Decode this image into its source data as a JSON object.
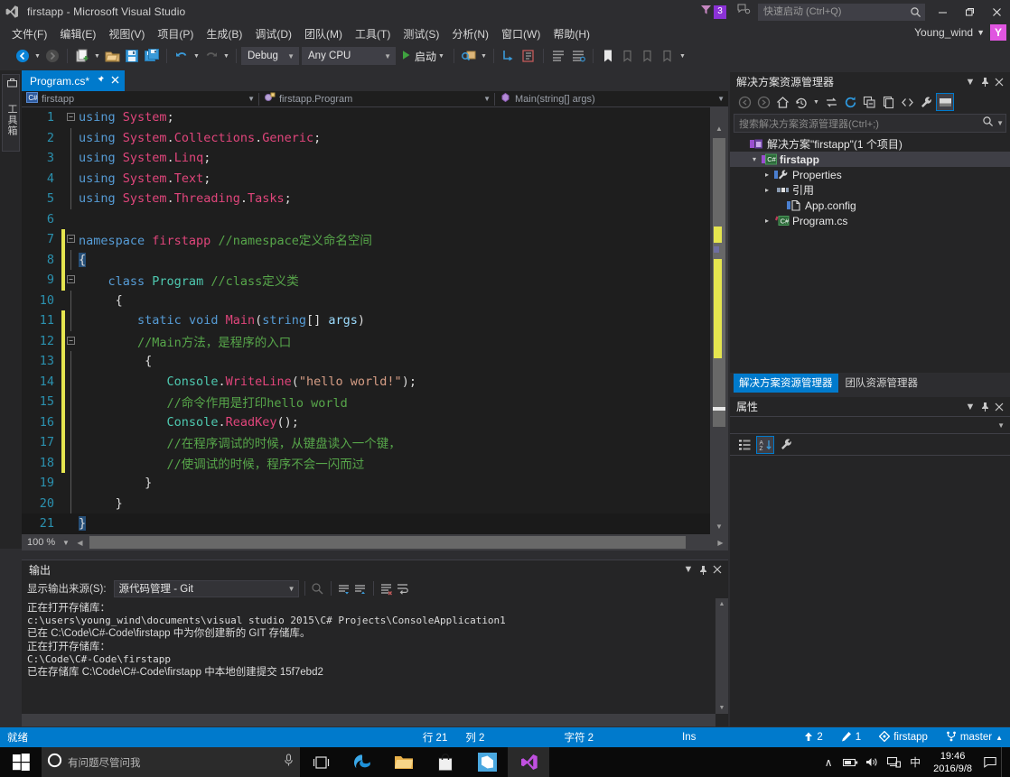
{
  "titlebar": {
    "app_title": "firstapp - Microsoft Visual Studio",
    "notification_count": "3",
    "quick_launch_placeholder": "快速启动 (Ctrl+Q)",
    "minimize": "─",
    "maximize": "❐",
    "close": "✕"
  },
  "menubar": {
    "items": [
      {
        "label": "文件(F)"
      },
      {
        "label": "编辑(E)"
      },
      {
        "label": "视图(V)"
      },
      {
        "label": "项目(P)"
      },
      {
        "label": "生成(B)"
      },
      {
        "label": "调试(D)"
      },
      {
        "label": "团队(M)"
      },
      {
        "label": "工具(T)"
      },
      {
        "label": "测试(S)"
      },
      {
        "label": "分析(N)"
      },
      {
        "label": "窗口(W)"
      },
      {
        "label": "帮助(H)"
      }
    ],
    "account_name": "Young_wind",
    "account_initial": "Y"
  },
  "toolbar": {
    "config": "Debug",
    "platform": "Any CPU",
    "start_label": "启动"
  },
  "left_rail": {
    "toolbox_label": "工具箱"
  },
  "editor": {
    "tab_label": "Program.cs*",
    "breadcrumb": {
      "project": "firstapp",
      "type": "firstapp.Program",
      "member": "Main(string[] args)"
    },
    "zoom_level": "100 %",
    "lines": [
      {
        "n": "1",
        "change": "none",
        "fold": "minus",
        "guide": false,
        "tokens": [
          {
            "t": "using ",
            "c": "kw"
          },
          {
            "t": "System",
            "c": "ns"
          },
          {
            "t": ";",
            "c": "pln"
          }
        ]
      },
      {
        "n": "2",
        "change": "none",
        "fold": "none",
        "guide": true,
        "tokens": [
          {
            "t": "using ",
            "c": "kw"
          },
          {
            "t": "System",
            "c": "ns"
          },
          {
            "t": ".",
            "c": "pln"
          },
          {
            "t": "Collections",
            "c": "ns"
          },
          {
            "t": ".",
            "c": "pln"
          },
          {
            "t": "Generic",
            "c": "ns"
          },
          {
            "t": ";",
            "c": "pln"
          }
        ]
      },
      {
        "n": "3",
        "change": "none",
        "fold": "none",
        "guide": true,
        "tokens": [
          {
            "t": "using ",
            "c": "kw"
          },
          {
            "t": "System",
            "c": "ns"
          },
          {
            "t": ".",
            "c": "pln"
          },
          {
            "t": "Linq",
            "c": "ns"
          },
          {
            "t": ";",
            "c": "pln"
          }
        ]
      },
      {
        "n": "4",
        "change": "none",
        "fold": "none",
        "guide": true,
        "tokens": [
          {
            "t": "using ",
            "c": "kw"
          },
          {
            "t": "System",
            "c": "ns"
          },
          {
            "t": ".",
            "c": "pln"
          },
          {
            "t": "Text",
            "c": "ns"
          },
          {
            "t": ";",
            "c": "pln"
          }
        ]
      },
      {
        "n": "5",
        "change": "none",
        "fold": "none",
        "guide": true,
        "tokens": [
          {
            "t": "using ",
            "c": "kw"
          },
          {
            "t": "System",
            "c": "ns"
          },
          {
            "t": ".",
            "c": "pln"
          },
          {
            "t": "Threading",
            "c": "ns"
          },
          {
            "t": ".",
            "c": "pln"
          },
          {
            "t": "Tasks",
            "c": "ns"
          },
          {
            "t": ";",
            "c": "pln"
          }
        ]
      },
      {
        "n": "6",
        "change": "none",
        "fold": "none",
        "guide": false,
        "tokens": []
      },
      {
        "n": "7",
        "change": "yellow",
        "fold": "minus",
        "guide": false,
        "tokens": [
          {
            "t": "namespace ",
            "c": "kw"
          },
          {
            "t": "firstapp",
            "c": "ns"
          },
          {
            "t": " ",
            "c": "pln"
          },
          {
            "t": "//namespace定义命名空间",
            "c": "cmt"
          }
        ]
      },
      {
        "n": "8",
        "change": "yellow",
        "fold": "none",
        "guide": true,
        "tokens": [
          {
            "t": "{",
            "c": "sel"
          }
        ]
      },
      {
        "n": "9",
        "change": "yellow",
        "fold": "minus",
        "guide": true,
        "tokens": [
          {
            "t": "    ",
            "c": "pln"
          },
          {
            "t": "class ",
            "c": "kw"
          },
          {
            "t": "Program",
            "c": "cls"
          },
          {
            "t": " ",
            "c": "pln"
          },
          {
            "t": "//class定义类",
            "c": "cmt"
          }
        ]
      },
      {
        "n": "10",
        "change": "none",
        "fold": "none",
        "guide": true,
        "tokens": [
          {
            "t": "     {",
            "c": "pln"
          }
        ]
      },
      {
        "n": "11",
        "change": "yellow",
        "fold": "none",
        "guide": true,
        "tokens": [
          {
            "t": "        ",
            "c": "pln"
          },
          {
            "t": "static ",
            "c": "kw"
          },
          {
            "t": "void ",
            "c": "kw"
          },
          {
            "t": "Main",
            "c": "mth"
          },
          {
            "t": "(",
            "c": "pln"
          },
          {
            "t": "string",
            "c": "kw"
          },
          {
            "t": "[] ",
            "c": "pln"
          },
          {
            "t": "args",
            "c": "par"
          },
          {
            "t": ")",
            "c": "pln"
          }
        ]
      },
      {
        "n": "12",
        "change": "yellow",
        "fold": "minus",
        "guide": true,
        "tokens": [
          {
            "t": "        ",
            "c": "pln"
          },
          {
            "t": "//Main方法，是程序的入口",
            "c": "cmt"
          }
        ]
      },
      {
        "n": "13",
        "change": "yellow",
        "fold": "none",
        "guide": true,
        "tokens": [
          {
            "t": "         {",
            "c": "pln"
          }
        ]
      },
      {
        "n": "14",
        "change": "yellow",
        "fold": "none",
        "guide": true,
        "tokens": [
          {
            "t": "            ",
            "c": "pln"
          },
          {
            "t": "Console",
            "c": "typ"
          },
          {
            "t": ".",
            "c": "pln"
          },
          {
            "t": "WriteLine",
            "c": "mth"
          },
          {
            "t": "(",
            "c": "pln"
          },
          {
            "t": "\"hello world!\"",
            "c": "str"
          },
          {
            "t": ");",
            "c": "pln"
          }
        ]
      },
      {
        "n": "15",
        "change": "yellow",
        "fold": "none",
        "guide": true,
        "tokens": [
          {
            "t": "            ",
            "c": "pln"
          },
          {
            "t": "//命令作用是打印hello world",
            "c": "cmt"
          }
        ]
      },
      {
        "n": "16",
        "change": "yellow",
        "fold": "none",
        "guide": true,
        "tokens": [
          {
            "t": "            ",
            "c": "pln"
          },
          {
            "t": "Console",
            "c": "typ"
          },
          {
            "t": ".",
            "c": "pln"
          },
          {
            "t": "ReadKey",
            "c": "mth"
          },
          {
            "t": "();",
            "c": "pln"
          }
        ]
      },
      {
        "n": "17",
        "change": "yellow",
        "fold": "none",
        "guide": true,
        "tokens": [
          {
            "t": "            ",
            "c": "pln"
          },
          {
            "t": "//在程序调试的时候，从键盘读入一个键，",
            "c": "cmt"
          }
        ]
      },
      {
        "n": "18",
        "change": "yellow",
        "fold": "none",
        "guide": true,
        "tokens": [
          {
            "t": "            ",
            "c": "pln"
          },
          {
            "t": "//使调试的时候，程序不会一闪而过",
            "c": "cmt"
          }
        ]
      },
      {
        "n": "19",
        "change": "none",
        "fold": "none",
        "guide": true,
        "tokens": [
          {
            "t": "         }",
            "c": "pln"
          }
        ]
      },
      {
        "n": "20",
        "change": "none",
        "fold": "none",
        "guide": true,
        "tokens": [
          {
            "t": "     }",
            "c": "pln"
          }
        ]
      },
      {
        "n": "21",
        "change": "none",
        "fold": "none",
        "guide": false,
        "current": true,
        "tokens": [
          {
            "t": "}",
            "c": "sel"
          }
        ]
      }
    ]
  },
  "output": {
    "title": "输出",
    "source_label": "显示输出来源(S):",
    "source_value": "源代码管理 - Git",
    "lines": [
      {
        "text": "正在打开存储库：",
        "mono": false
      },
      {
        "text": "c:\\users\\young_wind\\documents\\visual studio 2015\\C# Projects\\ConsoleApplication1",
        "mono": true
      },
      {
        "text": "已在 C:\\Code\\C#-Code\\firstapp 中为你创建新的 GIT 存储库。",
        "mono": false
      },
      {
        "text": "正在打开存储库：",
        "mono": false
      },
      {
        "text": "C:\\Code\\C#-Code\\firstapp",
        "mono": true
      },
      {
        "text": "已在存储库 C:\\Code\\C#-Code\\firstapp 中本地创建提交 15f7ebd2",
        "mono": false
      }
    ]
  },
  "solution_explorer": {
    "title": "解决方案资源管理器",
    "search_placeholder": "搜索解决方案资源管理器(Ctrl+;)",
    "tree": [
      {
        "label": "解决方案\"firstapp\"(1 个项目)",
        "indent": 0,
        "twisty": "none",
        "icon": "solution-icon",
        "bold": false,
        "selected": false
      },
      {
        "label": "firstapp",
        "indent": 1,
        "twisty": "down",
        "icon": "csproj-icon",
        "bold": true,
        "selected": true
      },
      {
        "label": "Properties",
        "indent": 2,
        "twisty": "right",
        "icon": "properties-icon",
        "bold": false,
        "selected": false
      },
      {
        "label": "引用",
        "indent": 2,
        "twisty": "right",
        "icon": "references-icon",
        "bold": false,
        "selected": false
      },
      {
        "label": "App.config",
        "indent": 3,
        "twisty": "none",
        "icon": "config-icon",
        "bold": false,
        "selected": false
      },
      {
        "label": "Program.cs",
        "indent": 2,
        "twisty": "right",
        "icon": "csfile-icon",
        "bold": false,
        "selected": false
      }
    ]
  },
  "dock_tabs": [
    {
      "label": "解决方案资源管理器",
      "active": true
    },
    {
      "label": "团队资源管理器",
      "active": false
    }
  ],
  "properties_panel": {
    "title": "属性"
  },
  "statusbar": {
    "ready": "就绪",
    "line_label": "行 21",
    "col_label": "列 2",
    "char_label": "字符 2",
    "ins_label": "Ins",
    "ahead_count": "2",
    "edit_count": "1",
    "repo": "firstapp",
    "branch": "master"
  },
  "taskbar": {
    "cortana_placeholder": "有问题尽管问我",
    "ime": "中",
    "time": "19:46",
    "date": "2016/9/8"
  },
  "colors": {
    "accent": "#007acc",
    "titlebar_bg": "#2d2d30",
    "editor_bg": "#1e1e1e",
    "panel_bg": "#252526",
    "badge_purple": "#8b32d6",
    "avatar_pink": "#e055e0",
    "change_bar_yellow": "#e5e54f"
  }
}
